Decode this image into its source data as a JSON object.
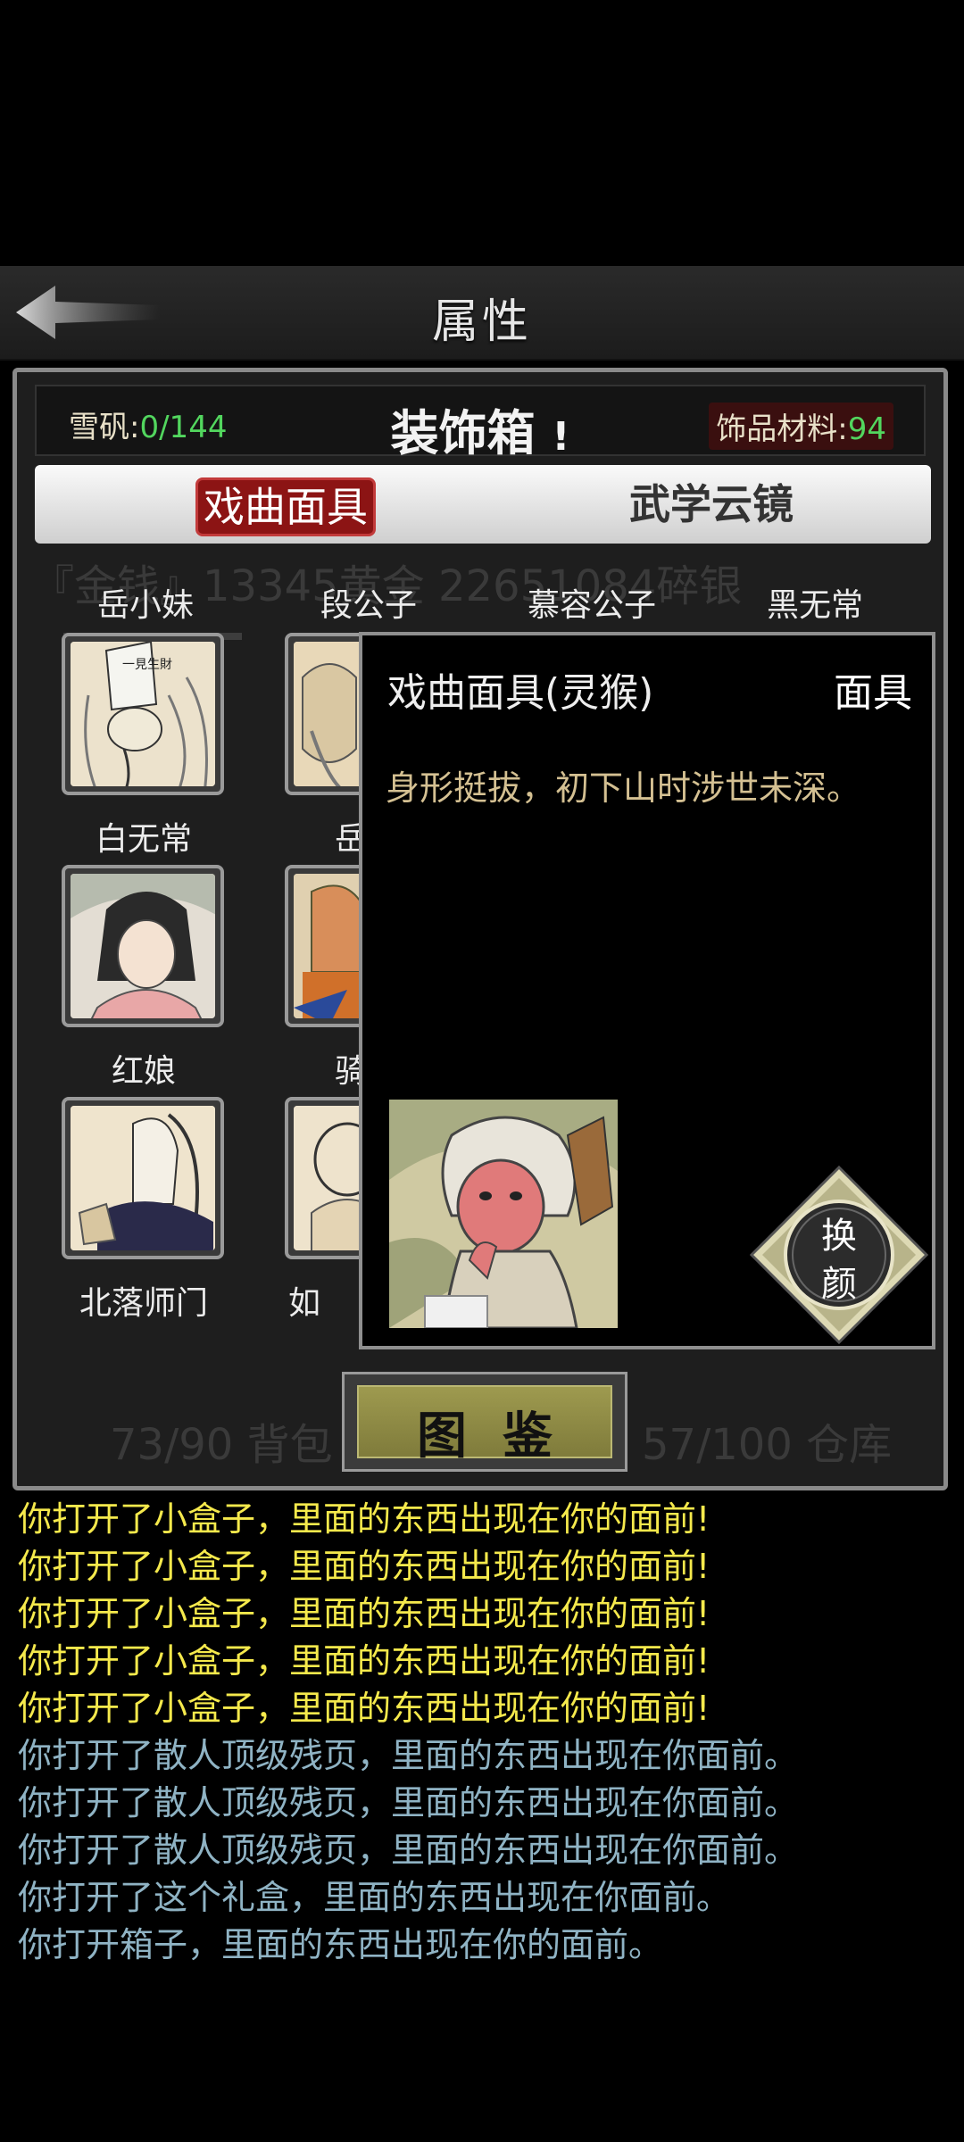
{
  "topbar": {
    "title": "属性",
    "back_icon": "back-arrow-icon"
  },
  "background_text": {
    "line1": "『金钱』13345黄金 22651084碎银",
    "line2": "73/90 背包",
    "line3": "57/100 仓库"
  },
  "header": {
    "left_label": "雪矾:",
    "left_value": "0/144",
    "title": "装饰箱",
    "title_mark": "!",
    "right_label": "饰品材料:",
    "right_value": "94"
  },
  "tabs": [
    {
      "label": "戏曲面具",
      "active": true
    },
    {
      "label": "武学云镜",
      "active": false
    }
  ],
  "top_names": [
    "岳小妹",
    "段公子",
    "慕容公子",
    "黑无常"
  ],
  "grid": [
    {
      "name": "白无常",
      "icon": "white-ghost-mask-icon"
    },
    {
      "name": "岳老",
      "icon": "elder-mask-icon"
    },
    {
      "name": "红娘",
      "icon": "hongniang-mask-icon"
    },
    {
      "name": "骑士",
      "icon": "knight-mask-icon"
    },
    {
      "name": "北落师门",
      "icon": "beiluo-mask-icon"
    },
    {
      "name": "如",
      "icon": "partial-mask-icon"
    }
  ],
  "popup": {
    "title": "戏曲面具(灵猴)",
    "type": "面具",
    "description": "身形挺拔，初下山时涉世未深。",
    "swap_label_1": "换",
    "swap_label_2": "颜",
    "art_icon": "spirit-monkey-portrait-icon"
  },
  "catalog_button": {
    "label": "图鉴"
  },
  "log": [
    {
      "text": "你打开了小盒子，里面的东西出现在你的面前!",
      "color": "#f5e94c"
    },
    {
      "text": "你打开了小盒子，里面的东西出现在你的面前!",
      "color": "#f5e94c"
    },
    {
      "text": "你打开了小盒子，里面的东西出现在你的面前!",
      "color": "#f5e94c"
    },
    {
      "text": "你打开了小盒子，里面的东西出现在你的面前!",
      "color": "#f5e94c"
    },
    {
      "text": "你打开了小盒子，里面的东西出现在你的面前!",
      "color": "#f5e94c"
    },
    {
      "text": "你打开了散人顶级残页，里面的东西出现在你面前。",
      "color": "#8fb3c4"
    },
    {
      "text": "你打开了散人顶级残页，里面的东西出现在你面前。",
      "color": "#8fb3c4"
    },
    {
      "text": "你打开了散人顶级残页，里面的东西出现在你面前。",
      "color": "#8fb3c4"
    },
    {
      "text": "你打开了这个礼盒，里面的东西出现在你面前。",
      "color": "#8fb3c4"
    },
    {
      "text": "你打开箱子，里面的东西出现在你的面前。",
      "color": "#8fb3c4"
    }
  ],
  "colors": {
    "accent_red": "#8c1414",
    "value_green": "#52d65e",
    "desc_gold": "#d4c092"
  }
}
